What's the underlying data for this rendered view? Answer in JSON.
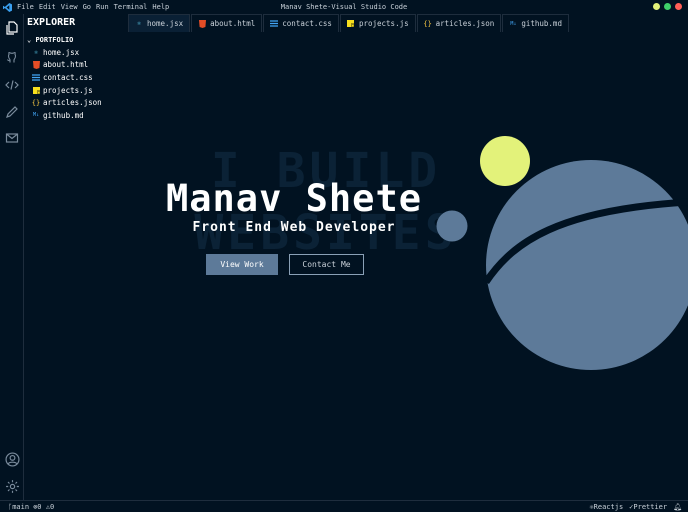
{
  "window": {
    "title": "Manav Shete-Visual Studio Code",
    "menu": [
      "File",
      "Edit",
      "View",
      "Go",
      "Run",
      "Terminal",
      "Help"
    ],
    "traffic_colors": [
      "#e3f27a",
      "#3fcf6a",
      "#ff5f57"
    ]
  },
  "explorer": {
    "title": "EXPLORER",
    "folder": "PORTFOLIO",
    "files": [
      {
        "name": "home.jsx",
        "icon": "react-icon",
        "color": "#61dafb"
      },
      {
        "name": "about.html",
        "icon": "html-icon",
        "color": "#e44d26"
      },
      {
        "name": "contact.css",
        "icon": "css-icon",
        "color": "#42a5f5"
      },
      {
        "name": "projects.js",
        "icon": "js-icon",
        "color": "#f7df1e"
      },
      {
        "name": "articles.json",
        "icon": "json-icon",
        "color": "#f5c542"
      },
      {
        "name": "github.md",
        "icon": "markdown-icon",
        "color": "#42a5f5"
      }
    ]
  },
  "tabs": [
    {
      "label": "home.jsx",
      "active": true
    },
    {
      "label": "about.html",
      "active": false
    },
    {
      "label": "contact.css",
      "active": false
    },
    {
      "label": "projects.js",
      "active": false
    },
    {
      "label": "articles.json",
      "active": false
    },
    {
      "label": "github.md",
      "active": false
    }
  ],
  "hero": {
    "background_text": [
      "I BUILD",
      "WEBSITES"
    ],
    "name": "Manav Shete",
    "role": "Front End Web Developer",
    "primary_button": "View Work",
    "secondary_button": "Contact Me",
    "accent_color": "#e3f27a",
    "shape_color": "#5d7a99"
  },
  "status": {
    "branch": "main",
    "errors": "0",
    "warnings": "0",
    "framework": "Reactjs",
    "formatter": "Prettier"
  }
}
